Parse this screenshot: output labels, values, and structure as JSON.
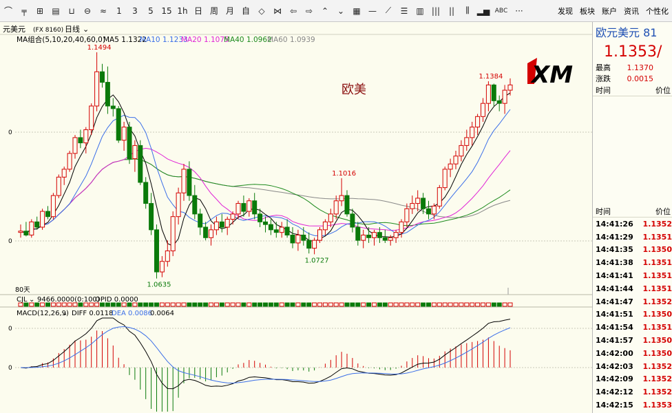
{
  "toolbar": {
    "tools": [
      "pointer-icon",
      "crosshair-icon",
      "zoom-icon",
      "kline-icon",
      "line-icon",
      "ruler-icon"
    ],
    "periods": [
      "1",
      "3",
      "5",
      "15",
      "1h",
      "日",
      "周",
      "月",
      "自"
    ],
    "menus": [
      "发现",
      "板块",
      "账户",
      "资讯",
      "个性化"
    ],
    "abc": "ABC",
    "more": "···"
  },
  "chart_header": {
    "instrument": "元美元",
    "code": "(FX 8160)",
    "period": "日线",
    "ma_group": "MA组合(5,10,20,40,60,0)",
    "ma_legend": [
      {
        "label": "MA5 1.1322",
        "color": "#000000"
      },
      {
        "label": "MA10 1.1233",
        "color": "#3a6ee8"
      },
      {
        "label": "MA20 1.1075",
        "color": "#e023d6"
      },
      {
        "label": "MA40 1.0962",
        "color": "#1d8a1d"
      },
      {
        "label": "MA60 1.0939",
        "color": "#888888"
      }
    ],
    "watermark": "欧美",
    "days_label": "80天"
  },
  "cjl": {
    "label": "CJL",
    "values": "9466.0000(0:100)",
    "opid": "OPID 0.0000"
  },
  "macd_header": {
    "label": "MACD(12,26,9)",
    "diff": "DIFF 0.0118",
    "dea": "DEA 0.0086",
    "macd": "0.0064",
    "diff_color": "#000000",
    "dea_color": "#3a6ee8"
  },
  "colors": {
    "up": "#d40000",
    "down": "#0a7a0a",
    "ma5": "#000000",
    "ma10": "#3a6ee8",
    "ma20": "#e023d6",
    "ma40": "#1d8a1d",
    "ma60": "#888888"
  },
  "annotations": [
    {
      "label": "1.1494",
      "value": 1.1494,
      "index": 14
    },
    {
      "label": "1.0635",
      "value": 1.0635,
      "index": 25
    },
    {
      "label": "1.1016",
      "value": 1.1016,
      "index": 59
    },
    {
      "label": "1.0727",
      "value": 1.0727,
      "index": 54
    },
    {
      "label": "1.1384",
      "value": 1.1384,
      "index": 86
    }
  ],
  "chart_data": {
    "type": "candlestick",
    "ohlc": [
      [
        1.081,
        1.084,
        1.079,
        1.0815
      ],
      [
        1.0815,
        1.085,
        1.0795,
        1.08
      ],
      [
        1.08,
        1.086,
        1.079,
        1.085
      ],
      [
        1.085,
        1.087,
        1.082,
        1.083
      ],
      [
        1.083,
        1.09,
        1.082,
        1.089
      ],
      [
        1.089,
        1.091,
        1.086,
        1.087
      ],
      [
        1.087,
        1.096,
        1.086,
        1.095
      ],
      [
        1.095,
        1.103,
        1.094,
        1.102
      ],
      [
        1.102,
        1.106,
        1.099,
        1.105
      ],
      [
        1.105,
        1.112,
        1.104,
        1.111
      ],
      [
        1.111,
        1.118,
        1.109,
        1.117
      ],
      [
        1.117,
        1.12,
        1.113,
        1.115
      ],
      [
        1.115,
        1.121,
        1.111,
        1.12
      ],
      [
        1.12,
        1.13,
        1.118,
        1.129
      ],
      [
        1.129,
        1.1494,
        1.127,
        1.142
      ],
      [
        1.142,
        1.145,
        1.136,
        1.138
      ],
      [
        1.138,
        1.144,
        1.126,
        1.129
      ],
      [
        1.129,
        1.132,
        1.125,
        1.128
      ],
      [
        1.128,
        1.129,
        1.115,
        1.116
      ],
      [
        1.116,
        1.123,
        1.112,
        1.121
      ],
      [
        1.121,
        1.123,
        1.107,
        1.109
      ],
      [
        1.109,
        1.116,
        1.104,
        1.114
      ],
      [
        1.114,
        1.116,
        1.099,
        1.1
      ],
      [
        1.1,
        1.102,
        1.09,
        1.092
      ],
      [
        1.092,
        1.096,
        1.08,
        1.082
      ],
      [
        1.082,
        1.084,
        1.0635,
        1.066
      ],
      [
        1.066,
        1.072,
        1.064,
        1.07
      ],
      [
        1.07,
        1.078,
        1.068,
        1.074
      ],
      [
        1.074,
        1.089,
        1.072,
        1.087
      ],
      [
        1.087,
        1.098,
        1.084,
        1.096
      ],
      [
        1.096,
        1.107,
        1.093,
        1.105
      ],
      [
        1.105,
        1.108,
        1.093,
        1.095
      ],
      [
        1.095,
        1.099,
        1.086,
        1.088
      ],
      [
        1.088,
        1.09,
        1.08,
        1.083
      ],
      [
        1.083,
        1.085,
        1.078,
        1.079
      ],
      [
        1.079,
        1.084,
        1.076,
        1.082
      ],
      [
        1.082,
        1.087,
        1.08,
        1.085
      ],
      [
        1.085,
        1.088,
        1.081,
        1.083
      ],
      [
        1.083,
        1.087,
        1.08,
        1.086
      ],
      [
        1.086,
        1.089,
        1.084,
        1.088
      ],
      [
        1.088,
        1.093,
        1.086,
        1.092
      ],
      [
        1.092,
        1.095,
        1.087,
        1.089
      ],
      [
        1.089,
        1.094,
        1.087,
        1.093
      ],
      [
        1.093,
        1.096,
        1.086,
        1.088
      ],
      [
        1.088,
        1.09,
        1.083,
        1.085
      ],
      [
        1.085,
        1.087,
        1.081,
        1.084
      ],
      [
        1.084,
        1.086,
        1.08,
        1.082
      ],
      [
        1.082,
        1.085,
        1.079,
        1.081
      ],
      [
        1.081,
        1.085,
        1.079,
        1.083
      ],
      [
        1.083,
        1.086,
        1.079,
        1.08
      ],
      [
        1.08,
        1.083,
        1.075,
        1.077
      ],
      [
        1.077,
        1.082,
        1.074,
        1.08
      ],
      [
        1.08,
        1.083,
        1.076,
        1.078
      ],
      [
        1.078,
        1.081,
        1.073,
        1.075
      ],
      [
        1.075,
        1.079,
        1.0727,
        1.078
      ],
      [
        1.078,
        1.083,
        1.077,
        1.082
      ],
      [
        1.082,
        1.086,
        1.08,
        1.085
      ],
      [
        1.085,
        1.09,
        1.083,
        1.088
      ],
      [
        1.088,
        1.095,
        1.086,
        1.093
      ],
      [
        1.093,
        1.1016,
        1.091,
        1.095
      ],
      [
        1.095,
        1.097,
        1.087,
        1.088
      ],
      [
        1.088,
        1.09,
        1.081,
        1.083
      ],
      [
        1.083,
        1.085,
        1.076,
        1.078
      ],
      [
        1.078,
        1.082,
        1.075,
        1.08
      ],
      [
        1.08,
        1.083,
        1.077,
        1.079
      ],
      [
        1.079,
        1.082,
        1.076,
        1.081
      ],
      [
        1.081,
        1.083,
        1.077,
        1.079
      ],
      [
        1.079,
        1.082,
        1.077,
        1.078
      ],
      [
        1.078,
        1.08,
        1.076,
        1.079
      ],
      [
        1.079,
        1.082,
        1.077,
        1.081
      ],
      [
        1.081,
        1.086,
        1.079,
        1.085
      ],
      [
        1.085,
        1.092,
        1.083,
        1.09
      ],
      [
        1.09,
        1.095,
        1.088,
        1.092
      ],
      [
        1.092,
        1.097,
        1.089,
        1.094
      ],
      [
        1.094,
        1.096,
        1.088,
        1.09
      ],
      [
        1.09,
        1.093,
        1.086,
        1.088
      ],
      [
        1.088,
        1.092,
        1.086,
        1.091
      ],
      [
        1.091,
        1.099,
        1.09,
        1.098
      ],
      [
        1.098,
        1.106,
        1.097,
        1.105
      ],
      [
        1.105,
        1.109,
        1.102,
        1.107
      ],
      [
        1.107,
        1.112,
        1.105,
        1.11
      ],
      [
        1.11,
        1.116,
        1.108,
        1.114
      ],
      [
        1.114,
        1.12,
        1.112,
        1.117
      ],
      [
        1.117,
        1.123,
        1.114,
        1.121
      ],
      [
        1.121,
        1.126,
        1.118,
        1.125
      ],
      [
        1.125,
        1.132,
        1.123,
        1.13
      ],
      [
        1.13,
        1.1384,
        1.127,
        1.137
      ],
      [
        1.137,
        1.1375,
        1.129,
        1.131
      ],
      [
        1.131,
        1.133,
        1.127,
        1.13
      ],
      [
        1.13,
        1.137,
        1.126,
        1.135
      ],
      [
        1.135,
        1.1395,
        1.133,
        1.137
      ]
    ],
    "ylim": [
      1.06,
      1.152
    ],
    "macd_ylim": [
      -0.005,
      0.013
    ]
  },
  "side": {
    "title": "欧元美元  81",
    "price": "1.1353/",
    "high_label": "最高",
    "high_value": "1.1370",
    "change_label": "涨跌",
    "change_value": "0.0015",
    "hdr_time": "时间",
    "hdr_price": "价位",
    "ticks_hdr_time": "时间",
    "ticks_hdr_price": "价位",
    "ticks": [
      {
        "time": "14:41:26",
        "price": "1.1352"
      },
      {
        "time": "14:41:29",
        "price": "1.1351"
      },
      {
        "time": "14:41:35",
        "price": "1.1350"
      },
      {
        "time": "14:41:38",
        "price": "1.1351"
      },
      {
        "time": "14:41:41",
        "price": "1.1351"
      },
      {
        "time": "14:41:44",
        "price": "1.1351"
      },
      {
        "time": "14:41:47",
        "price": "1.1352"
      },
      {
        "time": "14:41:51",
        "price": "1.1350"
      },
      {
        "time": "14:41:54",
        "price": "1.1351"
      },
      {
        "time": "14:41:57",
        "price": "1.1350"
      },
      {
        "time": "14:42:00",
        "price": "1.1350"
      },
      {
        "time": "14:42:03",
        "price": "1.1352"
      },
      {
        "time": "14:42:09",
        "price": "1.1352"
      },
      {
        "time": "14:42:12",
        "price": "1.1352"
      },
      {
        "time": "14:42:15",
        "price": "1.1353"
      }
    ]
  }
}
